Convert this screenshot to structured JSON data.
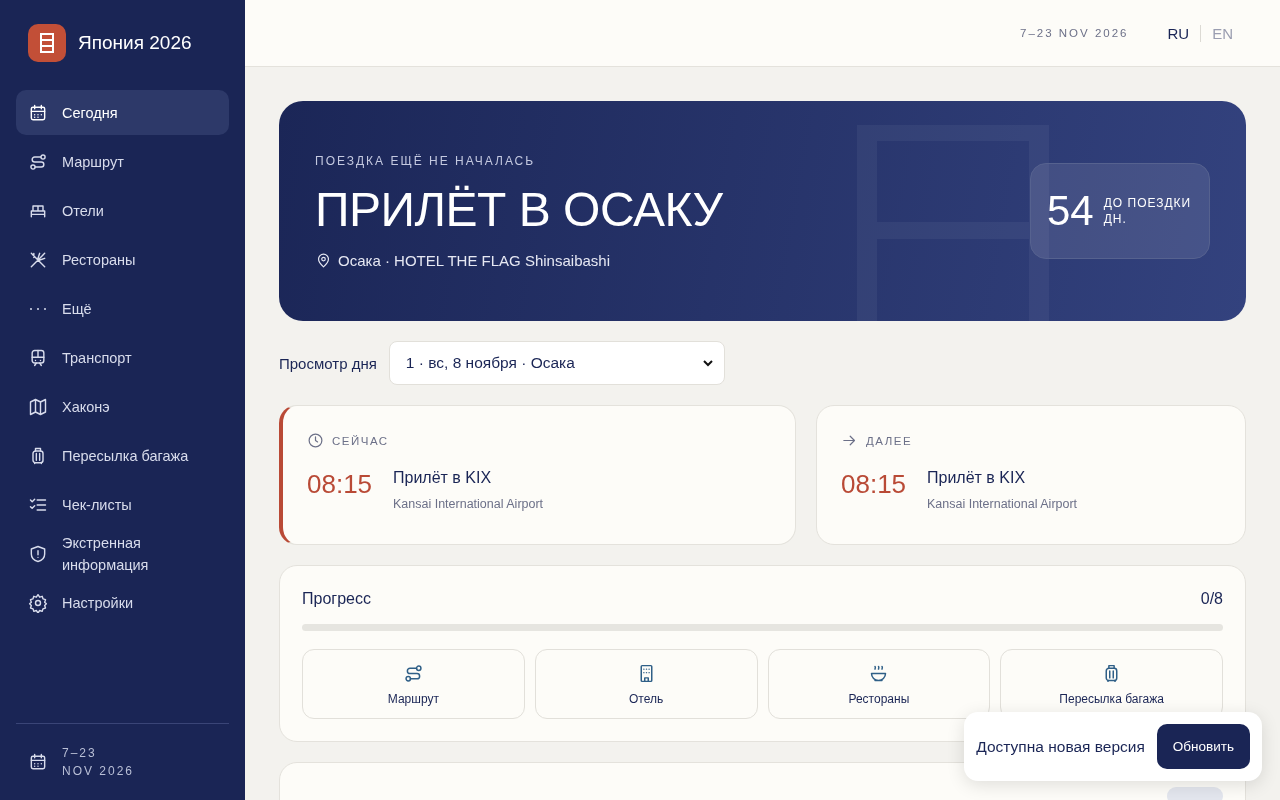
{
  "sidebar": {
    "brand": "Япония 2026",
    "items": [
      {
        "label": "Сегодня",
        "selected": true
      },
      {
        "label": "Маршрут",
        "selected": false
      },
      {
        "label": "Отели",
        "selected": false
      },
      {
        "label": "Рестораны",
        "selected": false
      },
      {
        "label": "Ещё",
        "selected": false
      },
      {
        "label": "Транспорт",
        "selected": false
      },
      {
        "label": "Хаконэ",
        "selected": false
      },
      {
        "label": "Пересылка багажа",
        "selected": false
      },
      {
        "label": "Чек-листы",
        "selected": false
      },
      {
        "label": "Экстренная информация",
        "selected": false
      },
      {
        "label": "Настройки",
        "selected": false
      }
    ],
    "footer": {
      "line1": "7–23",
      "line2": "NOV 2026"
    }
  },
  "header": {
    "dates": "7–23 NOV 2026",
    "languages": [
      {
        "label": "RU",
        "selected": true
      },
      {
        "label": "EN",
        "selected": false
      }
    ]
  },
  "hero": {
    "eyebrow": "ПОЕЗДКА ЕЩЁ НЕ НАЧАЛАСЬ",
    "title": "ПРИЛЁТ В ОСАКУ",
    "location": "Осака · HOTEL THE FLAG Shinsaibashi",
    "countdown": {
      "number": "54",
      "label1": "ДО ПОЕЗДКИ",
      "label2": "ДН."
    }
  },
  "day_view": {
    "label": "Просмотр дня",
    "value": "1 · вс, 8 ноября · Осака"
  },
  "events": [
    {
      "kind": "now",
      "heading": "СЕЙЧАС",
      "time": "08:15",
      "title": "Прилёт в KIX",
      "place": "Kansai International Airport"
    },
    {
      "kind": "next",
      "heading": "ДАЛЕЕ",
      "time": "08:15",
      "title": "Прилёт в KIX",
      "place": "Kansai International Airport"
    }
  ],
  "progress": {
    "title": "Прогресс",
    "count": "0/8",
    "level": 0,
    "tiles": [
      {
        "label": "Маршрут"
      },
      {
        "label": "Отель"
      },
      {
        "label": "Рестораны"
      },
      {
        "label": "Пересылка багажа"
      }
    ]
  },
  "toast": {
    "message": "Доступна новая версия",
    "button": "Обновить"
  }
}
